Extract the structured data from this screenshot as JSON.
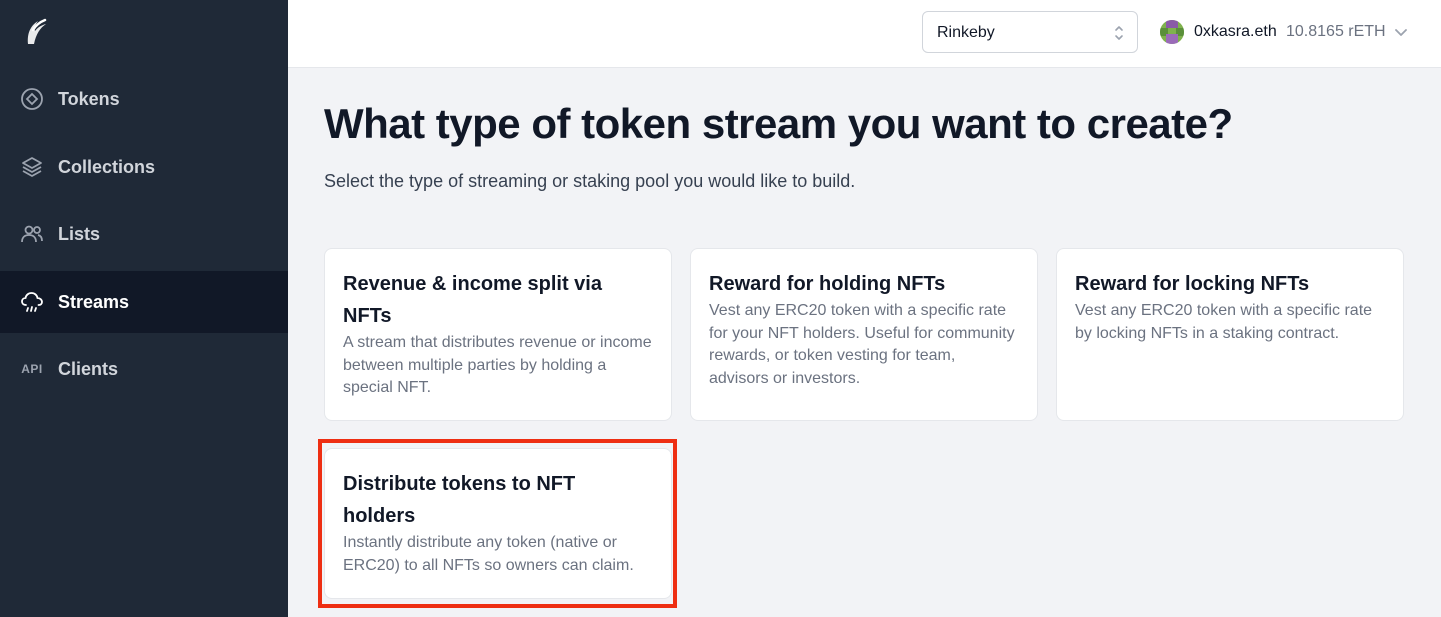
{
  "sidebar": {
    "logo_icon": "flame-logo-icon",
    "items": [
      {
        "label": "Tokens",
        "icon": "token-icon",
        "active": false
      },
      {
        "label": "Collections",
        "icon": "layers-icon",
        "active": false
      },
      {
        "label": "Lists",
        "icon": "users-icon",
        "active": false
      },
      {
        "label": "Streams",
        "icon": "cloud-rain-icon",
        "active": true
      },
      {
        "label": "Clients",
        "icon": "api-icon",
        "icon_text": "API",
        "active": false
      }
    ]
  },
  "topbar": {
    "network": "Rinkeby",
    "account": {
      "ens": "0xkasra.eth",
      "balance": "10.8165 rETH"
    }
  },
  "main": {
    "title": "What type of token stream you want to create?",
    "subtitle": "Select the type of streaming or staking pool you would like to build.",
    "cards": [
      {
        "title": "Revenue & income split via NFTs",
        "description": "A stream that distributes revenue or income between multiple parties by holding a special NFT."
      },
      {
        "title": "Reward for holding NFTs",
        "description": "Vest any ERC20 token with a specific rate for your NFT holders. Useful for community rewards, or token vesting for team, advisors or investors."
      },
      {
        "title": "Reward for locking NFTs",
        "description": "Vest any ERC20 token with a specific rate by locking NFTs in a staking contract."
      },
      {
        "title": "Distribute tokens to NFT holders",
        "description": "Instantly distribute any token (native or ERC20) to all NFTs so owners can claim."
      }
    ]
  },
  "colors": {
    "sidebar_bg": "#1f2937",
    "active_bg": "#111827",
    "highlight": "#ee2e12",
    "page_bg": "#f2f3f6"
  }
}
